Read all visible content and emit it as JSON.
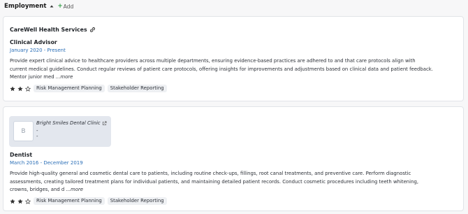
{
  "section": {
    "title": "Employment",
    "add_label": "Add",
    "icons": {
      "collapse": "caret-up-icon",
      "add": "plus-icon"
    }
  },
  "entries": [
    {
      "company": "CareWell Health Services",
      "company_icon": "link-icon",
      "role": "Clinical Advisor",
      "dates": "January 2020 - Present",
      "description_lines": [
        "Provide expert clinical advice to healthcare providers across multiple departments, ensuring evidence-based practices are adhered to and that care protocols align with",
        "current medical guidelines. Conduct regular reviews of patient care protocols, offering insights for improvements and adjustments based on clinical data and patient feedback.",
        "Mentor junior med "
      ],
      "more_label": "...more",
      "rating": {
        "value": 2,
        "max": 3
      },
      "skills": [
        "Risk Management Planning",
        "Stakeholder Reporting"
      ]
    },
    {
      "company": "Bright Smiles Dental Clinic",
      "company_icon": "external-link-icon",
      "logo_letter": "B",
      "company_details": [
        "-",
        "-"
      ],
      "role": "Dentist",
      "dates": "March 2016 - December 2019",
      "description_lines": [
        "Provide high-quality general and cosmetic dental care to patients, including routine check-ups, fillings, root canal treatments, and preventive care. Perform diagnostic",
        "assessments, creating tailored treatment plans for individual patients, and maintaining detailed patient records. Conduct cosmetic procedures including teeth whitening,",
        "crowns, bridges, and d "
      ],
      "more_label": "...more",
      "rating": {
        "value": 2,
        "max": 3
      },
      "skills": [
        "Risk Management Planning",
        "Stakeholder Reporting"
      ]
    }
  ],
  "colors": {
    "accent_add": "#2f9e44",
    "date_blue": "#2b6fb7",
    "chip_bg": "#eef0f3",
    "company_box_bg": "#e3e7ee",
    "star": "#333333"
  }
}
